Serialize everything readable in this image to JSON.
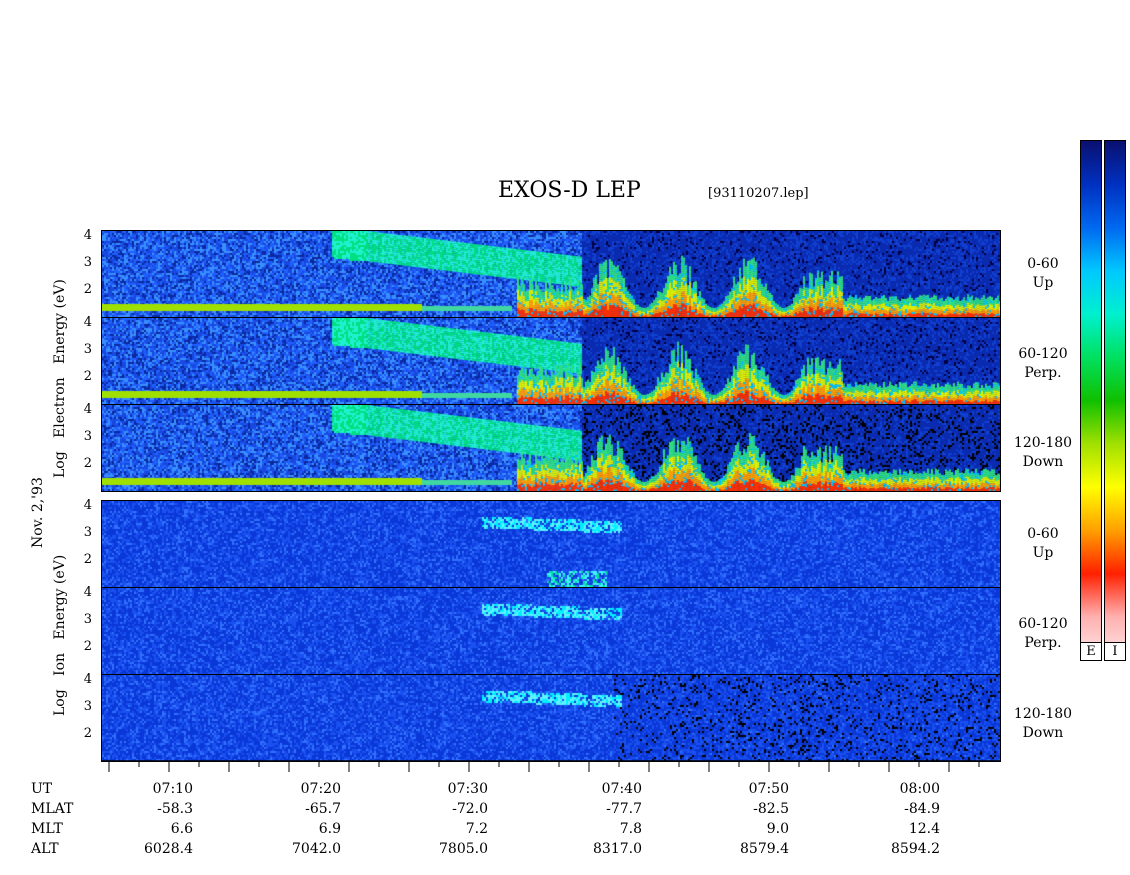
{
  "header": {
    "title": "EXOS-D LEP",
    "file": "[93110207.lep]"
  },
  "date_label": "Nov. 2,'93",
  "y_axes": {
    "electron": [
      "Log",
      "Electron",
      "Energy",
      "(eV)"
    ],
    "ion": [
      "Log",
      "Ion",
      "Energy",
      "(eV)"
    ]
  },
  "panels": [
    {
      "species": "Electron",
      "range": "0-60",
      "dir": "Up"
    },
    {
      "species": "Electron",
      "range": "60-120",
      "dir": "Perp."
    },
    {
      "species": "Electron",
      "range": "120-180",
      "dir": "Down"
    },
    {
      "species": "Ion",
      "range": "0-60",
      "dir": "Up"
    },
    {
      "species": "Ion",
      "range": "60-120",
      "dir": "Perp."
    },
    {
      "species": "Ion",
      "range": "120-180",
      "dir": "Down"
    }
  ],
  "panel_ticks": [
    "4",
    "3",
    "2"
  ],
  "colorbar": {
    "labels": [
      "E",
      "I"
    ],
    "colors": [
      "#0a1070",
      "#0030c0",
      "#0068f0",
      "#00c8ff",
      "#00f0d0",
      "#00e060",
      "#10c000",
      "#a0e000",
      "#ffff00",
      "#ffa000",
      "#ff2000",
      "#ffb0b0",
      "#ffe8e8"
    ]
  },
  "x_axis": {
    "row_labels": [
      "UT",
      "MLAT",
      "MLT",
      "ALT"
    ],
    "columns": [
      {
        "UT": "07:10",
        "MLAT": "-58.3",
        "MLT": "6.6",
        "ALT": "6028.4"
      },
      {
        "UT": "07:20",
        "MLAT": "-65.7",
        "MLT": "6.9",
        "ALT": "7042.0"
      },
      {
        "UT": "07:30",
        "MLAT": "-72.0",
        "MLT": "7.2",
        "ALT": "7805.0"
      },
      {
        "UT": "07:40",
        "MLAT": "-77.7",
        "MLT": "7.8",
        "ALT": "8317.0"
      },
      {
        "UT": "07:50",
        "MLAT": "-82.5",
        "MLT": "9.0",
        "ALT": "8579.4"
      },
      {
        "UT": "08:00",
        "MLAT": "-84.9",
        "MLT": "12.4",
        "ALT": "8594.2"
      }
    ]
  },
  "chart_data": {
    "type": "heatmap",
    "title": "EXOS-D LEP",
    "subtitle": "[93110207.lep]",
    "xlabel": "UT",
    "ylabel": "Log Energy (eV)",
    "y_ticks": [
      2,
      3,
      4
    ],
    "x_ticks": [
      "07:10",
      "07:20",
      "07:30",
      "07:40",
      "07:50",
      "08:00"
    ],
    "panels": [
      "Electron 0-60 Up",
      "Electron 60-120 Perp.",
      "Electron 120-180 Down",
      "Ion 0-60 Up",
      "Ion 60-120 Perp.",
      "Ion 120-180 Down"
    ]
  }
}
